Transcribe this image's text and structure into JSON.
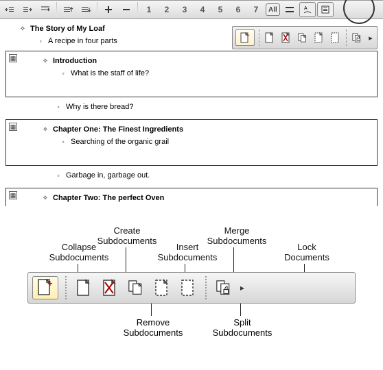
{
  "toolbar": {
    "levels": [
      "1",
      "2",
      "3",
      "4",
      "5",
      "6",
      "7"
    ],
    "all_label": "All"
  },
  "doc": {
    "title": "The Story of My Loaf",
    "subtitle": "A recipe in four parts",
    "subdocs": [
      {
        "heading": "Introduction",
        "sub": "What is the staff of life?",
        "after": "Why is there bread?"
      },
      {
        "heading": "Chapter One: The Finest Ingredients",
        "sub": "Searching of the organic grail",
        "after": "Garbage in, garbage out."
      },
      {
        "heading": "Chapter Two: The perfect Oven",
        "sub": "",
        "after": ""
      }
    ]
  },
  "mini_panel": {
    "icons": [
      "create-subdocument-icon",
      "remove-subdocument-icon",
      "insert-subdocument-icon",
      "merge-subdocument-icon",
      "split-subdocument-icon"
    ]
  },
  "big_labels": {
    "collapse": "Collapse\nSubdocuments",
    "create": "Create\nSubdocuments",
    "insert": "Insert\nSubdocuments",
    "merge": "Merge\nSubdocuments",
    "lock": "Lock\nDocuments",
    "remove": "Remove\nSubdocuments",
    "split": "Split\nSubdocuments"
  }
}
